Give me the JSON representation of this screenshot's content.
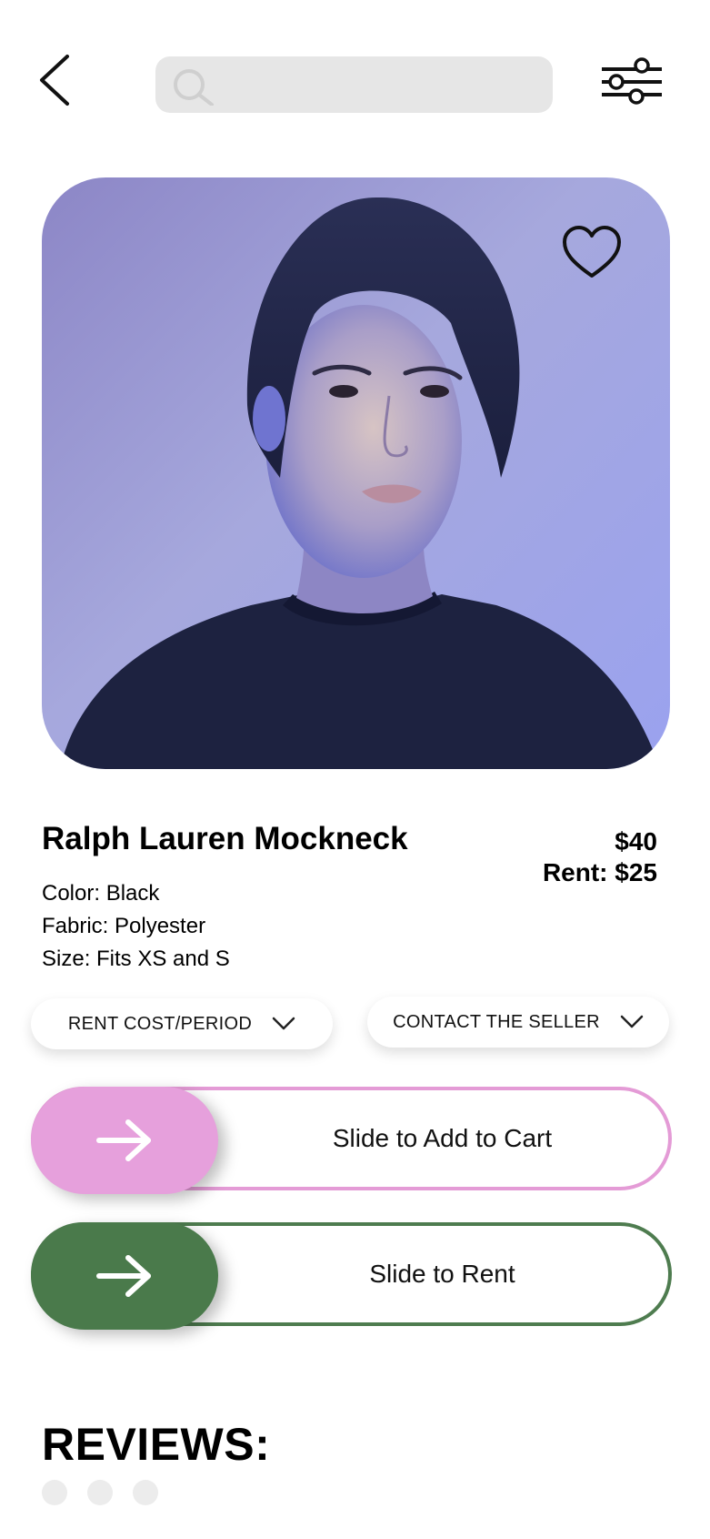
{
  "header": {
    "back_icon": "chevron-left-icon",
    "search": {
      "value": "",
      "placeholder": "",
      "icon": "search-icon"
    },
    "filter_icon": "sliders-icon"
  },
  "product": {
    "image_icon": "product-photo",
    "favorite_icon": "heart-icon",
    "name": "Ralph Lauren Mockneck",
    "price": "$40",
    "rent_price": "Rent: $25",
    "specs": {
      "color": "Color: Black",
      "fabric": "Fabric: Polyester",
      "size": "Size: Fits XS and S"
    }
  },
  "dropdowns": {
    "rent_cost": "RENT COST/PERIOD",
    "contact": "CONTACT THE SELLER"
  },
  "actions": {
    "cart": {
      "label": "Slide to Add to Cart",
      "color": "#e6a0dc"
    },
    "rent": {
      "label": "Slide to Rent",
      "color": "#4a7a4b"
    }
  },
  "reviews": {
    "title": "REVIEWS:"
  }
}
